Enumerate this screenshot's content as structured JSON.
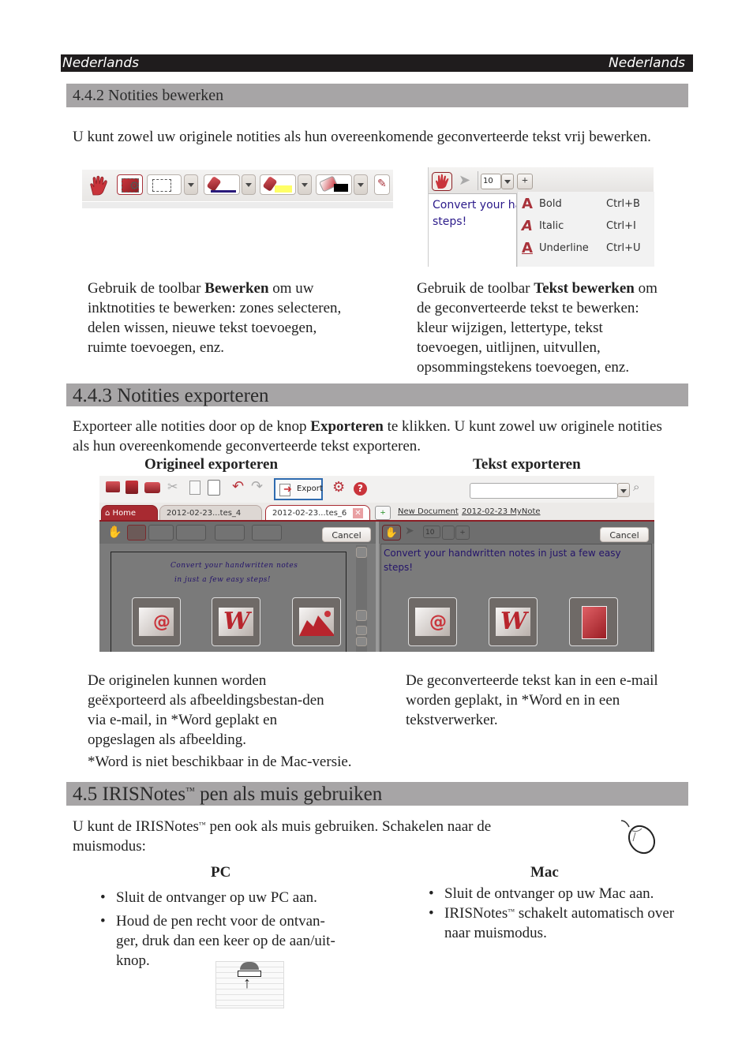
{
  "header": {
    "left_label": "Nederlands",
    "right_label": "Nederlands"
  },
  "section_442": {
    "title": "4.4.2 Notities bewerken",
    "intro": "U kunt zowel uw originele notities als hun overeenkomende geconverteerde tekst vrij bewerken.",
    "edit_toolbar": {
      "tools": [
        "hand-tool",
        "select-settings-tool",
        "selection-rectangle-tool",
        "pen-color-tool",
        "highlighter-tool",
        "eraser-tool",
        "insert-tool"
      ],
      "pen_color": "#2a1a7a",
      "highlighter_color": "#ffff66",
      "eraser_color": "#000000"
    },
    "text_toolbar": {
      "font_size": "10",
      "editor_text_line1": "Convert your ha",
      "editor_text_line2": "steps!",
      "menu": [
        {
          "label": "Bold",
          "shortcut": "Ctrl+B"
        },
        {
          "label": "Italic",
          "shortcut": "Ctrl+I"
        },
        {
          "label": "Underline",
          "shortcut": "Ctrl+U"
        }
      ]
    },
    "left_caption_pre": "Gebruik de toolbar ",
    "left_caption_bold": "Bewerken",
    "left_caption_post": " om uw inktnotities te bewerken: zones selecteren, delen wissen, nieuwe tekst toevoegen, ruimte toevoegen, enz.",
    "right_caption_pre": "Gebruik de toolbar ",
    "right_caption_bold": "Tekst bewerken",
    "right_caption_post": " om de geconverteerde tekst te bewerken: kleur wijzigen, lettertype, tekst toevoegen, uitlijnen, uitvullen, opsommingstekens toevoegen, enz."
  },
  "section_443": {
    "title": "4.4.3 Notities exporteren",
    "intro_pre": "Exporteer alle notities door op de knop ",
    "intro_bold": "Exporteren",
    "intro_post": " te klikken. U kunt zowel uw originele notities als hun overeenkomende geconverteerde tekst exporteren.",
    "col_left_heading": "Origineel exporteren",
    "col_right_heading": "Tekst exporteren",
    "app": {
      "export_button": "Export",
      "tabs": [
        "Home",
        "2012-02-23...tes_4",
        "2012-02-23...tes_6"
      ],
      "links": [
        "New Document",
        "2012-02-23  MyNote"
      ],
      "search_value": "",
      "cancel_label": "Cancel",
      "font_size": "10",
      "handwriting_line1": "Convert your handwritten notes",
      "handwriting_line2": "in just a few easy steps!",
      "converted_text": "Convert your handwritten notes in just a few easy steps!",
      "left_export_icons": [
        "email-icon",
        "word-icon",
        "image-icon"
      ],
      "right_export_icons": [
        "email-icon",
        "word-icon",
        "notepad-icon"
      ]
    },
    "left_caption": "De originelen kunnen worden geëxporteerd als afbeeldingsbestan-den via e-mail, in *Word geplakt en opgeslagen als afbeelding.",
    "footnote": "*Word is niet beschikbaar in de Mac-versie.",
    "right_caption": "De geconverteerde tekst kan in een e-mail worden geplakt, in *Word en in een tekstverwerker."
  },
  "section_45": {
    "title_pre": "4.5 IRISNotes",
    "title_tm": "™",
    "title_post": " pen als muis gebruiken",
    "intro_pre": "U kunt de IRISNotes",
    "intro_tm": "™",
    "intro_post": " pen ook als muis gebruiken. Schakelen naar de muismodus:",
    "pc": {
      "heading": "PC",
      "bullets": [
        "Sluit de ontvanger op uw PC aan.",
        "Houd de pen recht voor de ontvan-ger, druk dan een keer op de aan/uit-knop."
      ]
    },
    "mac": {
      "heading": "Mac",
      "bullet1": "Sluit de ontvanger op uw Mac aan.",
      "bullet2_pre": "IRISNotes",
      "bullet2_tm": "™",
      "bullet2_post": " schakelt automatisch over naar muismodus."
    }
  }
}
